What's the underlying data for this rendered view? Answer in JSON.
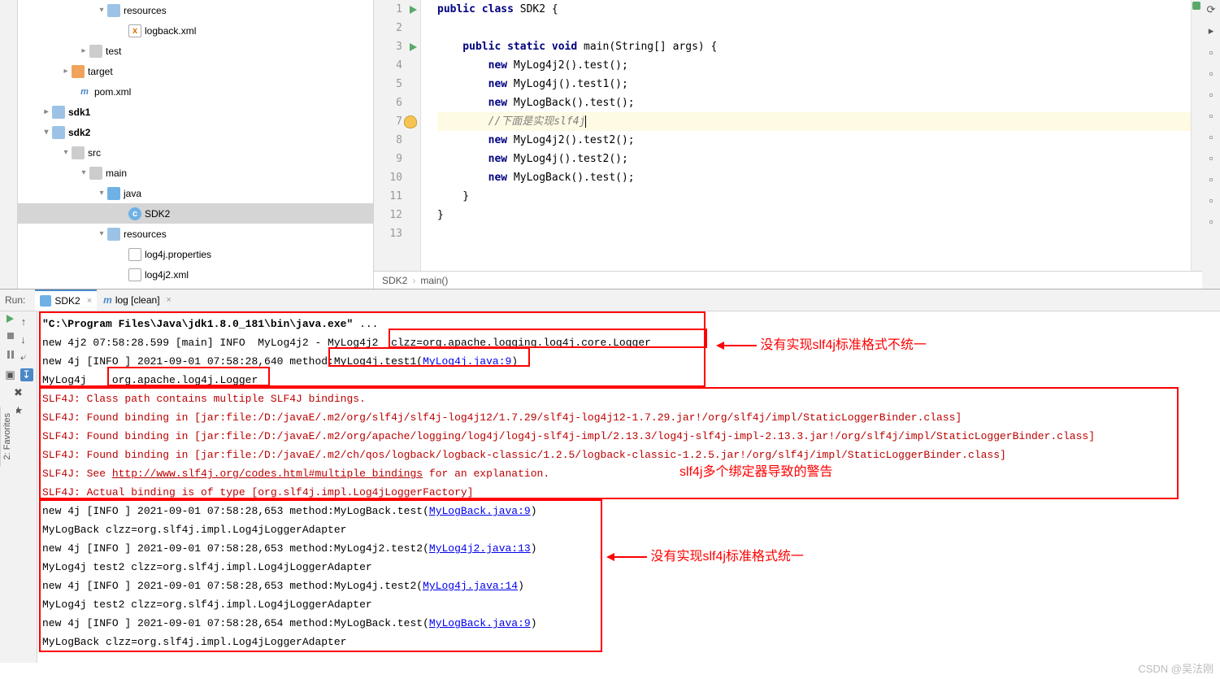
{
  "tree": {
    "resources": "resources",
    "logback": "logback.xml",
    "test": "test",
    "target": "target",
    "pom": "pom.xml",
    "sdk1": "sdk1",
    "sdk2": "sdk2",
    "src": "src",
    "main": "main",
    "java": "java",
    "cls": "SDK2",
    "resources2": "resources",
    "log4jprops": "log4j.properties",
    "log4j2xml": "log4j2.xml"
  },
  "gutter": [
    "1",
    "2",
    "3",
    "4",
    "5",
    "6",
    "7",
    "8",
    "9",
    "10",
    "11",
    "12",
    "13"
  ],
  "code": {
    "l1a": "public class ",
    "l1b": "SDK2 {",
    "l3a": "    public static void ",
    "l3b": "main(String[] args) {",
    "l4a": "        new ",
    "l4b": "MyLog4j2().test();",
    "l5a": "        new ",
    "l5b": "MyLog4j().test1();",
    "l6a": "        new ",
    "l6b": "MyLogBack().test();",
    "l7": "        //下面是实现slf4j",
    "l8a": "        new ",
    "l8b": "MyLog4j2().test2();",
    "l9a": "        new ",
    "l9b": "MyLog4j().test2();",
    "l10a": "        new ",
    "l10b": "MyLogBack().test();",
    "l11": "    }",
    "l12": "}"
  },
  "bc": {
    "a": "SDK2",
    "b": "main()"
  },
  "run": {
    "label": "Run:",
    "tab1": "SDK2",
    "tab2": "log [clean]"
  },
  "console": {
    "l1a": "\"C:\\Program Files\\Java\\jdk1.8.0_181\\bin\\java.exe\"",
    "l1b": " ...",
    "l2a": "new 4j2 07:58:28.599 [main] INFO  MyLog4j2 - MyLog4j2 ",
    "l2b": " clzz=org.apache.logging.log4j.core.Logger",
    "l3a": "new 4j [INFO ] 2021-09-01 07:58:28,640 method:",
    "l3b": "MyLog4j.test1(",
    "l3c": "MyLog4j.java:9",
    "l3d": ")",
    "l4a": "MyLog4j    ",
    "l4b": "org.apache.log4j.Logger",
    "e1": "SLF4J: Class path contains multiple SLF4J bindings.",
    "e2": "SLF4J: Found binding in [jar:file:/D:/javaE/.m2/org/slf4j/slf4j-log4j12/1.7.29/slf4j-log4j12-1.7.29.jar!/org/slf4j/impl/StaticLoggerBinder.class]",
    "e3": "SLF4J: Found binding in [jar:file:/D:/javaE/.m2/org/apache/logging/log4j/log4j-slf4j-impl/2.13.3/log4j-slf4j-impl-2.13.3.jar!/org/slf4j/impl/StaticLoggerBinder.class]",
    "e4": "SLF4J: Found binding in [jar:file:/D:/javaE/.m2/ch/qos/logback/logback-classic/1.2.5/logback-classic-1.2.5.jar!/org/slf4j/impl/StaticLoggerBinder.class]",
    "e5a": "SLF4J: See ",
    "e5b": "http://www.slf4j.org/codes.html#multiple_bindings",
    "e5c": " for an explanation.",
    "e6": "SLF4J: Actual binding is of type [org.slf4j.impl.Log4jLoggerFactory]",
    "o1a": "new 4j [INFO ] 2021-09-01 07:58:28,653 method:MyLogBack.test(",
    "o1b": "MyLogBack.java:9",
    "o1c": ")",
    "o2": "MyLogBack clzz=org.slf4j.impl.Log4jLoggerAdapter",
    "o3a": "new 4j [INFO ] 2021-09-01 07:58:28,653 method:MyLog4j2.test2(",
    "o3b": "MyLog4j2.java:13",
    "o3c": ")",
    "o4": "MyLog4j test2 clzz=org.slf4j.impl.Log4jLoggerAdapter",
    "o5a": "new 4j [INFO ] 2021-09-01 07:58:28,653 method:MyLog4j.test2(",
    "o5b": "MyLog4j.java:14",
    "o5c": ")",
    "o6": "MyLog4j test2 clzz=org.slf4j.impl.Log4jLoggerAdapter",
    "o7a": "new 4j [INFO ] 2021-09-01 07:58:28,654 method:MyLogBack.test(",
    "o7b": "MyLogBack.java:9",
    "o7c": ")",
    "o8": "MyLogBack clzz=org.slf4j.impl.Log4jLoggerAdapter"
  },
  "annot": {
    "a1": "没有实现slf4j标准格式不统一",
    "a2": "slf4j多个绑定器导致的警告",
    "a3": "没有实现slf4j标准格式统一"
  },
  "watermark": "CSDN @吴法刚",
  "vtab": "2: Favorites"
}
